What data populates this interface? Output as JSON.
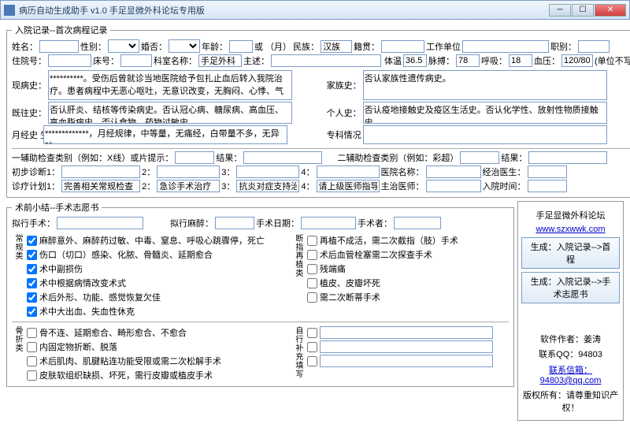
{
  "window": {
    "title": "病历自动生成助手 v1.0 手足显微外科论坛专用版"
  },
  "section1": {
    "legend": "入院记录--首次病程记录"
  },
  "labels": {
    "name": "姓名：",
    "sex": "性别：",
    "marry": "婚否：",
    "age": "年龄：",
    "age_unit": "或 （月）",
    "nation": "民族：",
    "nation_v": "汉族",
    "native": "籍贯：",
    "work": "工作单位",
    "job": "职别：",
    "inno": "住院号：",
    "bed": "床号：",
    "dept": "科室名称：",
    "dept_v": "手足外科",
    "chief": "主述：",
    "temp": "体温",
    "temp_v": "36.5",
    "pulse": "脉搏：",
    "pulse_v": "78",
    "breath": "呼吸：",
    "breath_v": "18",
    "bp": "血压：",
    "bp_v": "120/80",
    "bp_unit": "(单位不写)",
    "now": "现病史：",
    "now_v": "**********。受伤后曾就诊当地医院给予包扎止血后转入我院治疗。患者病程中无恶心呕吐，无意识改变，无胸闷、心悸、气促、呼吸困难，精神饮食尚可，睡眠好，二便正常。",
    "family": "家族史：",
    "family_v": "否认家族性遗传病史。",
    "past": "既往史：",
    "past_v": "否认肝炎、结核等传染病史。否认冠心病、糖尿病、高血压、高血脂病史。否认食物、药物过敏史。",
    "personal": "个人史：",
    "personal_v": "否认疫地接触史及疫区生活史。否认化学性、放射性物质接触史。",
    "menses": "月经史\n生育史",
    "menses_v": "*************，月经规律，中等量，无痛经，白带量不多，无异味。",
    "special": "专科情况",
    "aux1": "一辅助检查类别（例如：X线）或片提示：",
    "result": "结果：",
    "aux2": "二辅助检查类别（例如：彩超）",
    "diag1": "初步诊断1：",
    "d2": "2：",
    "d3": "3：",
    "d4": "4：",
    "hosp": "医院名称：",
    "doctor": "经治医生：",
    "plan": "诊疗计划1：",
    "plan_v": "完善相关常规检查",
    "p2_v": "急诊手术治疗",
    "p3_v": "抗炎对症支持治疗",
    "p4_v": "请上级医师指导",
    "attend": "主治医师：",
    "intime": "入院时间："
  },
  "section2": {
    "legend": "术前小结--手术志愿书",
    "plan_op": "拟行手术：",
    "plan_anes": "拟行麻醉：",
    "op_date": "手术日期：",
    "surgeon": "手术者："
  },
  "checks1_label": "常规类",
  "checks1": [
    {
      "c": true,
      "t": "麻醉意外、麻醉药过敏、中毒、窒息、呼吸心跳骤停，死亡"
    },
    {
      "c": true,
      "t": "伤口（切口）感染、化脓、骨髓炎、延期愈合"
    },
    {
      "c": true,
      "t": "术中副损伤"
    },
    {
      "c": true,
      "t": "术中根据病情改变术式"
    },
    {
      "c": true,
      "t": "术后外形、功能、感觉恢复欠佳"
    },
    {
      "c": true,
      "t": "术中大出血、失血性休克"
    }
  ],
  "checks2_label": "骨折类",
  "checks2": [
    {
      "c": false,
      "t": "骨不连、延期愈合、畸形愈合、不愈合"
    },
    {
      "c": false,
      "t": "内固定物折断、脱落"
    },
    {
      "c": false,
      "t": "术后肌肉、肌腱粘连功能受限或需二次松解手术"
    },
    {
      "c": false,
      "t": "皮肤软组织缺损、坏死，需行皮瓣或植皮手术"
    }
  ],
  "checks3_label": "断指再植类",
  "checks3": [
    {
      "c": false,
      "t": "再植不成活，需二次截指（肢）手术"
    },
    {
      "c": false,
      "t": "术后血管栓塞需二次探查手术"
    },
    {
      "c": false,
      "t": "残端痛"
    },
    {
      "c": false,
      "t": "植皮、皮瓣坏死"
    },
    {
      "c": false,
      "t": "需二次断蒂手术"
    }
  ],
  "checks4_label": "自行补充填写",
  "side": {
    "forum": "手足显微外科论坛",
    "url": "www.szxwwk.com",
    "btn1": "生成：入院记录-->首程",
    "btn2": "生成：入院记录-->手术志愿书",
    "author": "软件作者：姜涛",
    "qq": "联系QQ：94803",
    "mail": "联系信箱：94803@qq.com",
    "copy": "版权所有：请尊重知识产权！"
  }
}
